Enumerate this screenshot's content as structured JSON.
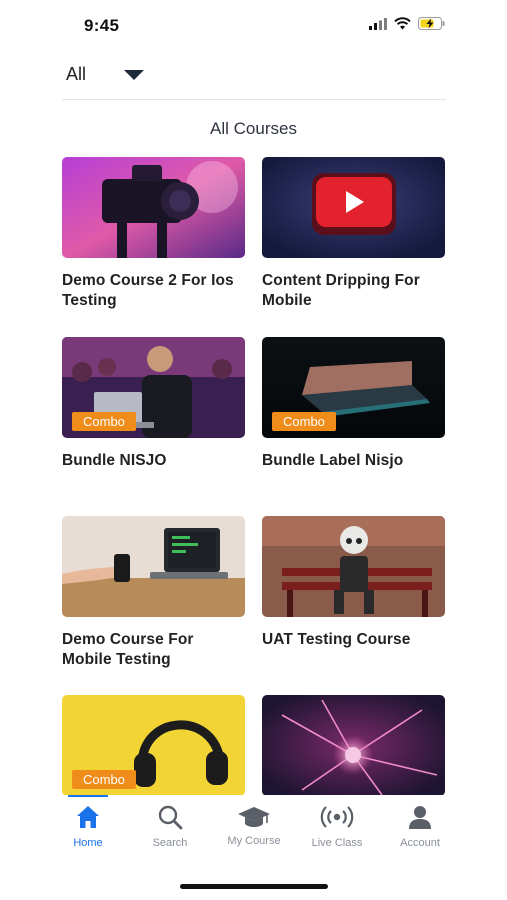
{
  "status_bar": {
    "time": "9:45",
    "icons": [
      "signal-icon",
      "wifi-icon",
      "battery-charging-icon"
    ]
  },
  "filter": {
    "selected": "All",
    "icon": "caret-down-icon"
  },
  "section_title": "All Courses",
  "courses": [
    {
      "title": "Demo Course 2 For Ios Testing",
      "badge": "",
      "thumb": "film-camera-thumbnail"
    },
    {
      "title": "Content Dripping For Mobile",
      "badge": "",
      "thumb": "play-button-thumbnail"
    },
    {
      "title": "Bundle NISJO",
      "badge": "Combo",
      "thumb": "audience-laptop-thumbnail"
    },
    {
      "title": "Bundle Label Nisjo",
      "badge": "Combo",
      "thumb": "laptop-dark-thumbnail"
    },
    {
      "title": "Demo Course For Mobile Testing",
      "badge": "",
      "thumb": "phone-laptop-desk-thumbnail"
    },
    {
      "title": "UAT Testing Course",
      "badge": "",
      "thumb": "robot-bench-thumbnail"
    },
    {
      "title": "",
      "badge": "Combo",
      "thumb": "headphones-yellow-thumbnail"
    },
    {
      "title": "",
      "badge": "",
      "thumb": "neuron-thumbnail"
    }
  ],
  "tabs": [
    {
      "label": "Home",
      "icon": "home-icon",
      "active": true
    },
    {
      "label": "Search",
      "icon": "search-icon",
      "active": false
    },
    {
      "label": "My Course",
      "icon": "graduation-cap-icon",
      "active": false
    },
    {
      "label": "Live Class",
      "icon": "broadcast-icon",
      "active": false
    },
    {
      "label": "Account",
      "icon": "user-icon",
      "active": false
    }
  ],
  "colors": {
    "accent": "#1a73e8",
    "badge": "#f08c1a",
    "tab_inactive": "#8a8f98"
  }
}
